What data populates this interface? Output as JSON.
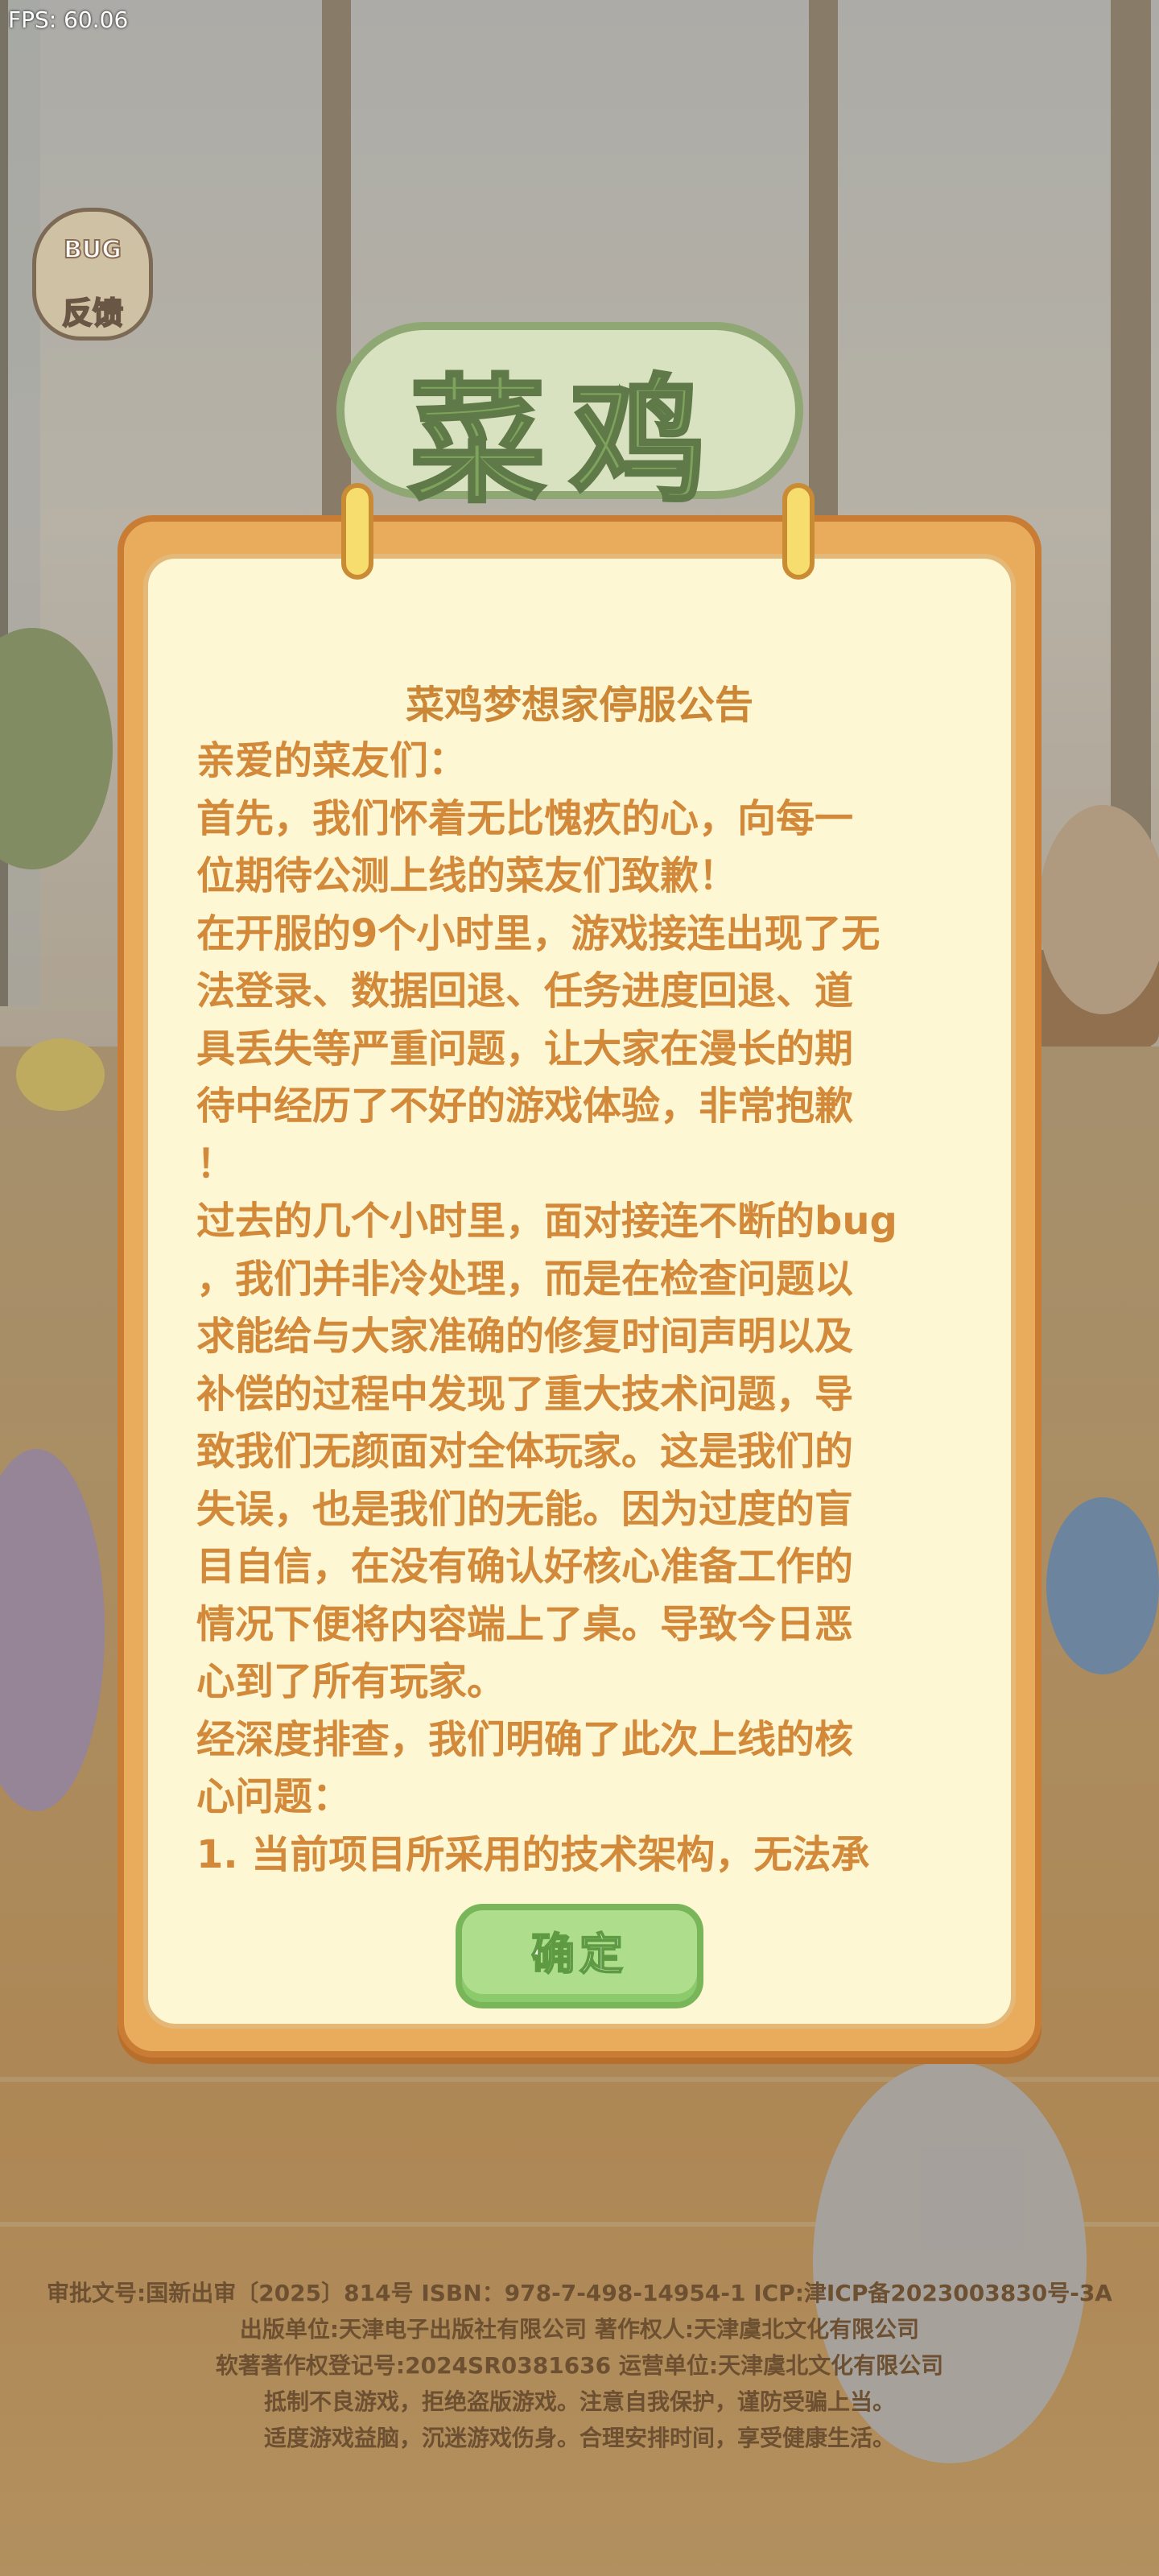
{
  "overlay": {
    "fps": "FPS: 60.06"
  },
  "bug_button": {
    "word": "BUG",
    "label": "反馈"
  },
  "logo": {
    "text": "菜鸡"
  },
  "notice": {
    "title": "菜鸡梦想家停服公告",
    "lines": [
      "亲爱的菜友们：",
      "首先，我们怀着无比愧疚的心，向每一",
      "位期待公测上线的菜友们致歉！",
      "在开服的9个小时里，游戏接连出现了无",
      "法登录、数据回退、任务进度回退、道",
      "具丢失等严重问题，让大家在漫长的期",
      "待中经历了不好的游戏体验，非常抱歉",
      "！",
      "过去的几个小时里，面对接连不断的bug",
      "，我们并非冷处理，而是在检查问题以",
      "求能给与大家准确的修复时间声明以及",
      "补偿的过程中发现了重大技术问题，导",
      "致我们无颜面对全体玩家。这是我们的",
      "失误，也是我们的无能。因为过度的盲",
      "目自信，在没有确认好核心准备工作的",
      "情况下便将内容端上了桌。导致今日恶",
      "心到了所有玩家。",
      "经深度排查，我们明确了此次上线的核",
      "心问题：",
      "1. 当前项目所采用的技术架构，无法承"
    ],
    "confirm_label": "确定"
  },
  "footer": {
    "lines": [
      "审批文号:国新出审〔2025〕814号   ISBN：978-7-498-14954-1  ICP:津ICP备2023003830号-3A",
      "出版单位:天津电子出版社有限公司   著作权人:天津虞北文化有限公司",
      "软著著作权登记号:2024SR0381636   运营单位:天津虞北文化有限公司",
      "抵制不良游戏，拒绝盗版游戏。注意自我保护，谨防受骗上当。",
      "适度游戏益脑，沉迷游戏伤身。合理安排时间，享受健康生活。"
    ]
  }
}
